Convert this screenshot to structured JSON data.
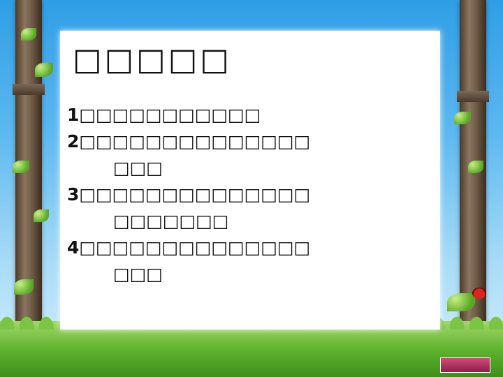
{
  "slide": {
    "title": "□□□□□",
    "items": [
      {
        "num": "1",
        "text": "□□□□□□□□□□□",
        "cont": ""
      },
      {
        "num": "2",
        "text": "□□□□□□□□□□□□□□",
        "cont": "□□□"
      },
      {
        "num": "3",
        "text": "□□□□□□□□□□□□□□",
        "cont": "□□□□□□□"
      },
      {
        "num": "4",
        "text": "□□□□□□□□□□□□□□",
        "cont": "□□□"
      }
    ]
  }
}
